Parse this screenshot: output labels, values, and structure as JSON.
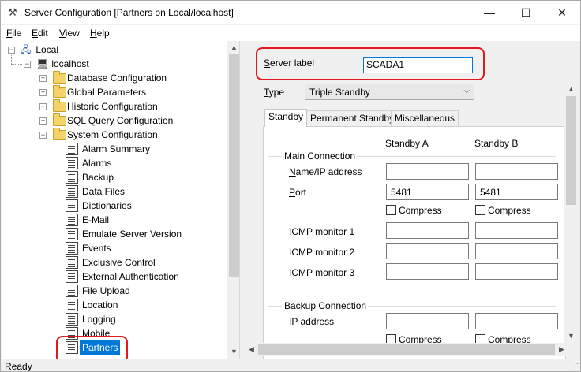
{
  "window": {
    "title": "Server Configuration [Partners on Local/localhost]",
    "min_glyph": "—",
    "max_glyph": "☐",
    "close_glyph": "✕"
  },
  "menubar": [
    {
      "mnemonic": "F",
      "rest": "ile"
    },
    {
      "mnemonic": "E",
      "rest": "dit"
    },
    {
      "mnemonic": "V",
      "rest": "iew"
    },
    {
      "mnemonic": "H",
      "rest": "elp"
    }
  ],
  "tree": {
    "root": "Local",
    "host": "localhost",
    "folders": [
      "Database Configuration",
      "Global Parameters",
      "Historic Configuration",
      "SQL Query Configuration",
      "System Configuration"
    ],
    "items": [
      "Alarm Summary",
      "Alarms",
      "Backup",
      "Data Files",
      "Dictionaries",
      "E-Mail",
      "Emulate Server Version",
      "Events",
      "Exclusive Control",
      "External Authentication",
      "File Upload",
      "Location",
      "Logging",
      "Mobile",
      "Partners"
    ],
    "selected": "Partners"
  },
  "form": {
    "server_label": {
      "mnemonic": "S",
      "rest": "erver label",
      "value": "SCADA1"
    },
    "type": {
      "mnemonic": "T",
      "rest": "ype",
      "value": "Triple Standby"
    },
    "tabs": [
      "Standby",
      "Permanent Standby",
      "Miscellaneous"
    ],
    "active_tab": "Standby",
    "col_a": "Standby A",
    "col_b": "Standby B",
    "main_connection": "Main Connection",
    "name_ip": {
      "mnemonic": "N",
      "rest": "ame/IP address"
    },
    "port": {
      "mnemonic": "P",
      "rest": "ort"
    },
    "port_a": "5481",
    "port_b": "5481",
    "compress": "Compress",
    "icmp1": "ICMP monitor 1",
    "icmp2": "ICMP monitor 2",
    "icmp3": "ICMP monitor 3",
    "backup_connection": "Backup Connection",
    "ip_address": {
      "mnemonic": "I",
      "rest": "P address"
    }
  },
  "status": "Ready",
  "colors": {
    "selection": "#0078d7",
    "highlight": "#e0191c",
    "folder": "#f5d36b"
  },
  "icons": [
    "network-icon",
    "computer-icon",
    "folder-icon",
    "properties-icon"
  ]
}
